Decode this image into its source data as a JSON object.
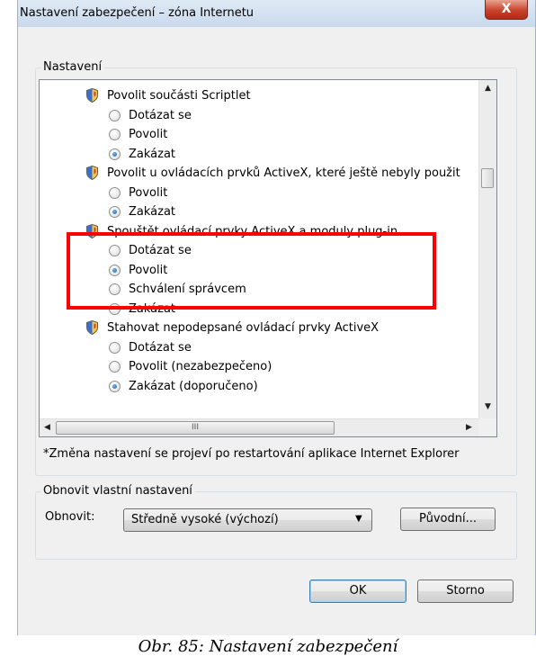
{
  "window": {
    "title": "Nastavení zabezpečení – zóna Internetu",
    "close_label": "X"
  },
  "settings_group": {
    "label": "Nastavení"
  },
  "settings_list": [
    {
      "type": "category",
      "icon": "shield-icon",
      "label": "Povolit součásti Scriptlet"
    },
    {
      "type": "option",
      "label": "Dotázat se",
      "checked": false
    },
    {
      "type": "option",
      "label": "Povolit",
      "checked": false
    },
    {
      "type": "option",
      "label": "Zakázat",
      "checked": true
    },
    {
      "type": "category",
      "icon": "shield-icon",
      "label": "Povolit u ovládacích prvků ActiveX, které ještě nebyly použit"
    },
    {
      "type": "option",
      "label": "Povolit",
      "checked": false
    },
    {
      "type": "option",
      "label": "Zakázat",
      "checked": true
    },
    {
      "type": "category",
      "icon": "shield-icon",
      "label": "Spouštět ovládací prvky ActiveX a moduly plug-in"
    },
    {
      "type": "option",
      "label": "Dotázat se",
      "checked": false
    },
    {
      "type": "option",
      "label": "Povolit",
      "checked": true
    },
    {
      "type": "option",
      "label": "Schválení správcem",
      "checked": false
    },
    {
      "type": "option",
      "label": "Zakázat",
      "checked": false
    },
    {
      "type": "category",
      "icon": "shield-icon",
      "label": "Stahovat nepodepsané ovládací prvky ActiveX"
    },
    {
      "type": "option",
      "label": "Dotázat se",
      "checked": false
    },
    {
      "type": "option",
      "label": "Povolit (nezabezpečeno)",
      "checked": false
    },
    {
      "type": "option",
      "label": "Zakázat (doporučeno)",
      "checked": true
    }
  ],
  "scrollbar": {
    "h_thumb_grip": "III"
  },
  "note": "*Změna nastavení se projeví po restartování aplikace Internet Explorer",
  "reset_group": {
    "label": "Obnovit vlastní nastavení",
    "reset_label": "Obnovit:",
    "reset_value": "Středně vysoké (výchozí)",
    "reset_button": "Původní..."
  },
  "footer": {
    "ok": "OK",
    "cancel": "Storno"
  },
  "caption": "Obr. 85: Nastavení zabezpečení",
  "colors": {
    "highlight": "#ff0000",
    "close": "#c8432b"
  }
}
